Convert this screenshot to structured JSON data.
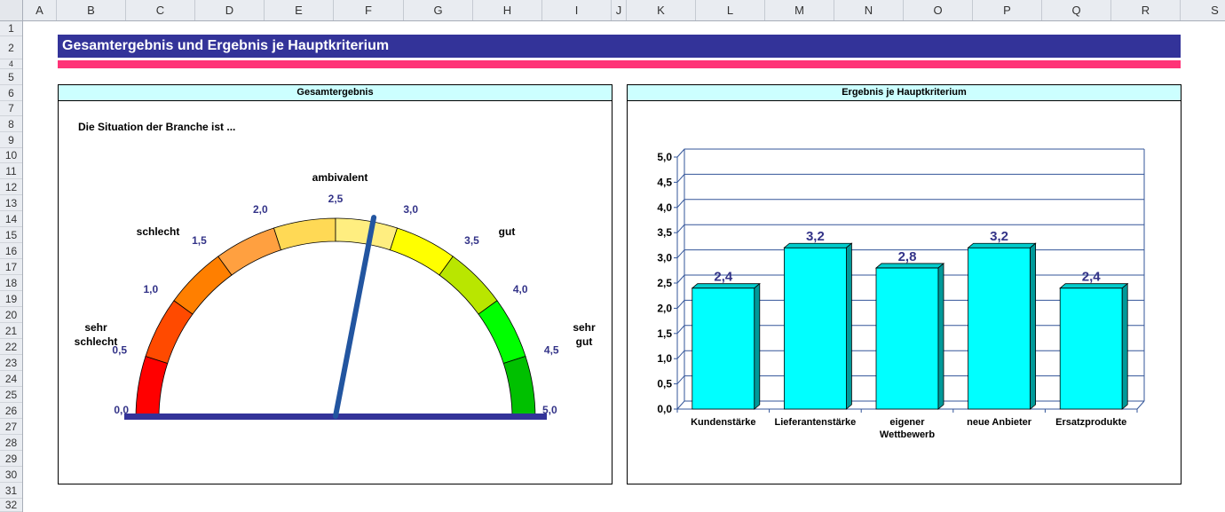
{
  "spreadsheet": {
    "columns": [
      "A",
      "B",
      "C",
      "D",
      "E",
      "F",
      "G",
      "H",
      "I",
      "J",
      "K",
      "L",
      "M",
      "N",
      "O",
      "P",
      "Q",
      "R",
      "S"
    ],
    "rows": [
      "1",
      "2",
      "4",
      "5",
      "6",
      "7",
      "8",
      "9",
      "10",
      "11",
      "12",
      "13",
      "14",
      "15",
      "16",
      "17",
      "18",
      "19",
      "20",
      "21",
      "22",
      "23",
      "24",
      "25",
      "26",
      "27",
      "28",
      "29",
      "30",
      "31",
      "32"
    ]
  },
  "title": "Gesamtergebnis und Ergebnis je Hauptkriterium",
  "gauge_panel": {
    "header": "Gesamtergebnis",
    "intro": "Die Situation der Branche ist ...",
    "value": 2.8,
    "min": 0,
    "max": 5,
    "tick_labels": [
      "0,0",
      "0,5",
      "1,0",
      "1,5",
      "2,0",
      "2,5",
      "3,0",
      "3,5",
      "4,0",
      "4,5",
      "5,0"
    ],
    "band_colors": [
      "#ff0000",
      "#ff4a00",
      "#ff7f00",
      "#ffa040",
      "#ffd955",
      "#ffee80",
      "#ffff00",
      "#b9e600",
      "#00ff00",
      "#00c000"
    ],
    "labels": {
      "sehr_schlecht_1": "sehr",
      "sehr_schlecht_2": "schlecht",
      "schlecht": "schlecht",
      "ambivalent": "ambivalent",
      "gut": "gut",
      "sehr_gut_1": "sehr",
      "sehr_gut_2": "gut"
    }
  },
  "bar_panel": {
    "header": "Ergebnis je Hauptkriterium"
  },
  "chart_data": {
    "type": "bar",
    "categories": [
      "Kundenstärke",
      "Lieferantenstärke",
      "eigener Wettbewerb",
      "neue Anbieter",
      "Ersatzprodukte"
    ],
    "category_lines": [
      [
        "Kundenstärke"
      ],
      [
        "Lieferantenstärke"
      ],
      [
        "eigener",
        "Wettbewerb"
      ],
      [
        "neue Anbieter"
      ],
      [
        "Ersatzprodukte"
      ]
    ],
    "values": [
      2.4,
      3.2,
      2.8,
      3.2,
      2.4
    ],
    "value_labels": [
      "2,4",
      "3,2",
      "2,8",
      "3,2",
      "2,4"
    ],
    "ylim": [
      0,
      5
    ],
    "yticks": [
      "0,0",
      "0,5",
      "1,0",
      "1,5",
      "2,0",
      "2,5",
      "3,0",
      "3,5",
      "4,0",
      "4,5",
      "5,0"
    ],
    "bar_color": "#00ffff",
    "grid": true
  }
}
